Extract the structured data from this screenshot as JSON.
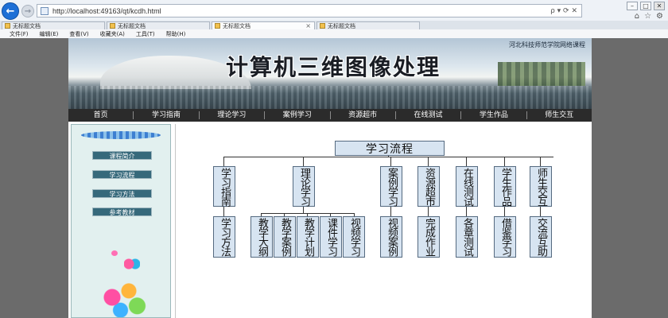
{
  "browser": {
    "url": "http://localhost:49163/qt/kcdh.html",
    "tabs": [
      {
        "label": "无标题文档",
        "active": false
      },
      {
        "label": "无标题文档",
        "active": false
      },
      {
        "label": "无标题文档",
        "active": true
      },
      {
        "label": "无标题文档",
        "active": false
      }
    ],
    "menu": [
      "文件(F)",
      "编辑(E)",
      "查看(V)",
      "收藏夹(A)",
      "工具(T)",
      "帮助(H)"
    ],
    "address_tools": "ρ ▾ ⟳ ✕"
  },
  "banner": {
    "title": "计算机三维图像处理",
    "school": "河北科技师范学院网络课程"
  },
  "navbar": [
    "首页",
    "学习指南",
    "理论学习",
    "案例学习",
    "资源超市",
    "在线测试",
    "学生作品",
    "师生交互"
  ],
  "sidebar": [
    "课程简介",
    "学习流程",
    "学习方法",
    "参考教材"
  ],
  "flow": {
    "title": "学习流程",
    "sections": [
      {
        "label": "学习指南",
        "children": [
          "学习方法"
        ]
      },
      {
        "label": "理论学习",
        "children": [
          "教学大纲",
          "教学案例",
          "教学计划",
          "课件学习",
          "视频学习"
        ]
      },
      {
        "label": "案例学习",
        "children": [
          "视频案例"
        ]
      },
      {
        "label": "资源超市",
        "children": [
          "完成作业"
        ]
      },
      {
        "label": "在线测试",
        "children": [
          "各章测试"
        ]
      },
      {
        "label": "学生作品",
        "children": [
          "借鉴学习"
        ]
      },
      {
        "label": "师生交互",
        "children": [
          "交流互助"
        ]
      }
    ]
  },
  "colors": {
    "navbar_bg": "#2b2b2b",
    "sidebar_btn": "#36697b",
    "box_fill": "#d7e4f1"
  }
}
